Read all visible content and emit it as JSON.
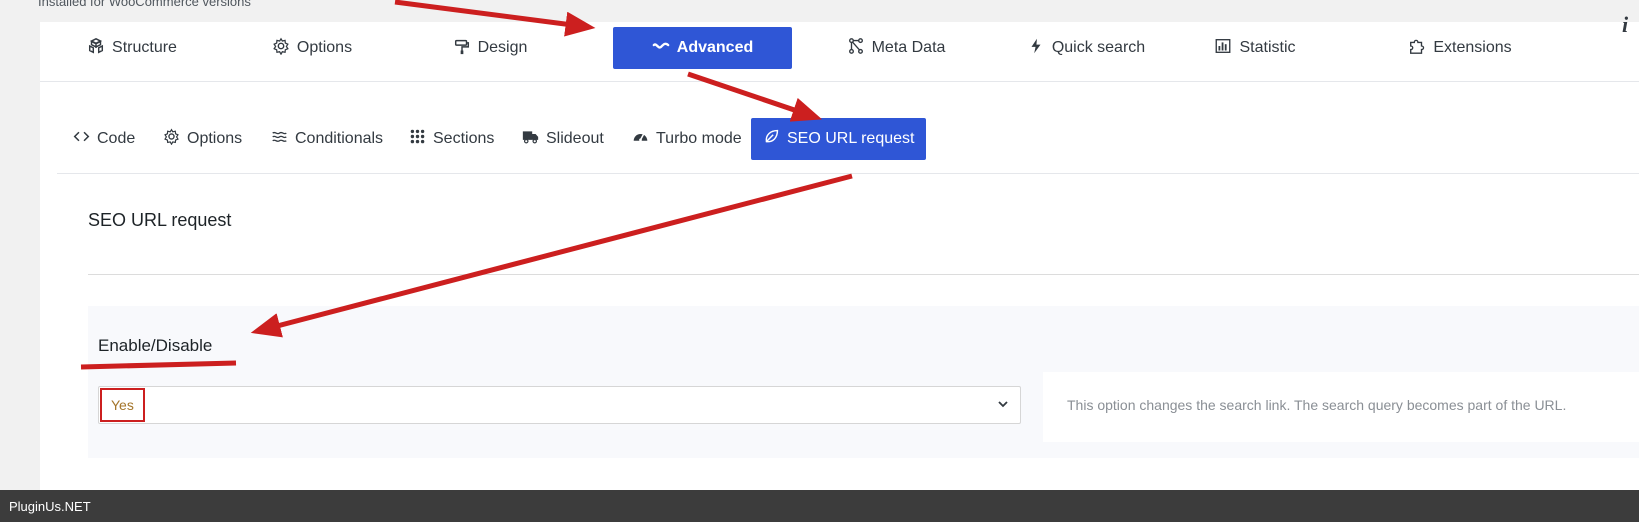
{
  "top_strip": "Installed for WooCommerce versions",
  "main_tabs": [
    {
      "label": "Structure",
      "icon": "cubes-icon"
    },
    {
      "label": "Options",
      "icon": "gear-icon"
    },
    {
      "label": "Design",
      "icon": "paint-roller-icon"
    },
    {
      "label": "Advanced",
      "icon": "wave-icon",
      "active": true
    },
    {
      "label": "Meta Data",
      "icon": "nodes-icon"
    },
    {
      "label": "Quick search",
      "icon": "bolt-icon"
    },
    {
      "label": "Statistic",
      "icon": "bar-chart-icon"
    },
    {
      "label": "Extensions",
      "icon": "puzzle-icon"
    }
  ],
  "sub_tabs": [
    {
      "label": "Code",
      "icon": "code-icon"
    },
    {
      "label": "Options",
      "icon": "gear-icon"
    },
    {
      "label": "Conditionals",
      "icon": "water-icon"
    },
    {
      "label": "Sections",
      "icon": "grid-dots-icon"
    },
    {
      "label": "Slideout",
      "icon": "truck-icon"
    },
    {
      "label": "Turbo mode",
      "icon": "speedometer-icon"
    },
    {
      "label": "SEO URL request",
      "icon": "leaf-icon",
      "active": true
    }
  ],
  "section": {
    "title": "SEO URL request",
    "option_label": "Enable/Disable",
    "select_value": "Yes",
    "help_text": "This option changes the search link. The search query becomes part of the URL."
  },
  "footer": {
    "text": "PluginUs.NET"
  },
  "colors": {
    "accent": "#2f56d6",
    "annotation": "#cc1f1f",
    "select_value": "#a4752a"
  }
}
